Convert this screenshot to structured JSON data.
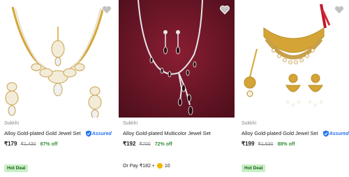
{
  "products": [
    {
      "brand": "Sukkhi",
      "title": "Alloy Gold-plated Gold Jewel Set",
      "price": "₹179",
      "mrp": "₹1,430",
      "discount": "87% off",
      "assured": true,
      "assured_label": "Assured",
      "badge": "Hot Deal",
      "image_icon": "necklace-earrings-maangtikka-white-background",
      "wishlist_icon": "heart-icon"
    },
    {
      "brand": "Sukkhi",
      "title": "Alloy Gold-plated Multicolor Jewel Set",
      "price": "₹192",
      "mrp": "₹700",
      "discount": "72% off",
      "assured": false,
      "pay_prefix": "Or Pay ₹182 +",
      "pay_coins": "10",
      "image_icon": "necklace-earrings-maroon-background",
      "wishlist_icon": "heart-icon"
    },
    {
      "brand": "Sukkhi",
      "title": "Alloy Gold-plated Gold Jewel Set",
      "price": "₹199",
      "mrp": "₹1,630",
      "discount": "88% off",
      "assured": true,
      "assured_label": "Assured",
      "badge": "Hot Deal",
      "image_icon": "choker-earrings-maangtikka-white-background",
      "wishlist_icon": "heart-icon"
    }
  ],
  "colors": {
    "discount_green": "#388e3c",
    "hot_deal_bg": "#c8f0c4",
    "assured_blue": "#2874f0",
    "maroon_bg": "#6d1626",
    "gold": "#d4a536"
  }
}
